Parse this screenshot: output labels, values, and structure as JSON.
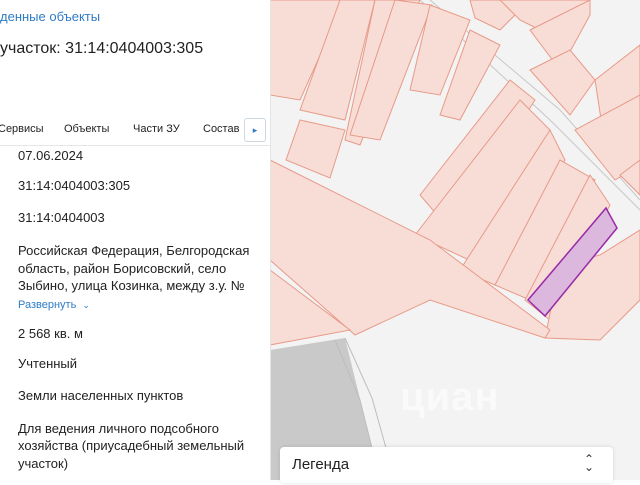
{
  "panel": {
    "back_link": "денные объекты",
    "title": "участок: 31:14:0404003:305",
    "tabs": [
      {
        "label": "Сервисы"
      },
      {
        "label": "Объекты"
      },
      {
        "label": "Части ЗУ"
      },
      {
        "label": "Состав"
      }
    ],
    "tab_more_icon": "chevron-right-icon",
    "fields": {
      "date": "07.06.2024",
      "cad_number": "31:14:0404003:305",
      "quarter": "31:14:0404003",
      "address_line1": "Российская Федерация, Белгородская",
      "address_line2": "область, район Борисовский, село",
      "address_line3": "Зыбино, улица Козинка, между з.у. №",
      "expand": "Развернуть",
      "area": "2 568 кв. м",
      "status": "Учтенный",
      "category": "Земли населенных пунктов",
      "use_line1": "Для ведения личного подсобного",
      "use_line2": "хозяйства (приусадебный земельный",
      "use_line3": "участок)"
    }
  },
  "map": {
    "parcel_fill": "#f7ddd6",
    "parcel_stroke": "#e89a88",
    "selected_fill": "#dcb8de",
    "selected_stroke": "#9a2aa8",
    "gray_area": "#c8c8c8",
    "watermark": "циан"
  },
  "legend": {
    "title": "Легенда",
    "toggle_icon": "up-down-chevron-icon"
  }
}
